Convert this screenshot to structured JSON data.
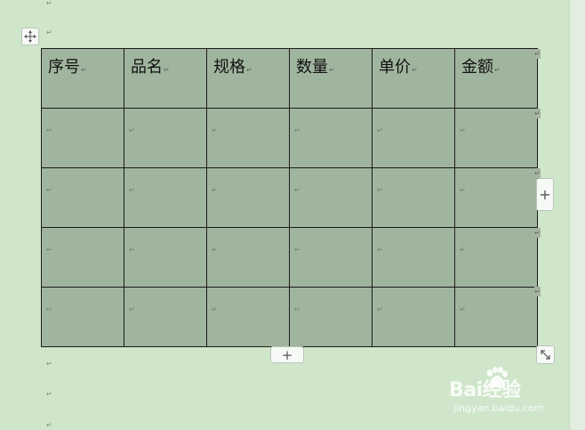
{
  "document": {
    "paragraph_mark": "↵",
    "table": {
      "headers": [
        "序号",
        "品名",
        "规格",
        "数量",
        "单价",
        "金额"
      ],
      "header_mark": "↵",
      "body_rows": 4,
      "cell_mark": "↵"
    },
    "row_end_mark": "↵"
  },
  "controls": {
    "add_column_label": "+",
    "add_row_label": "+"
  },
  "watermark": {
    "brand": "Bai经验",
    "url": "jingyan.baidu.com"
  },
  "colors": {
    "page_background": "#cfe6cb",
    "table_fill": "#a0b59e",
    "table_border": "#1a1a1a"
  },
  "icons": {
    "move": "move-arrows-icon",
    "resize": "resize-diagonal-icon",
    "paw": "baidu-paw-icon"
  }
}
